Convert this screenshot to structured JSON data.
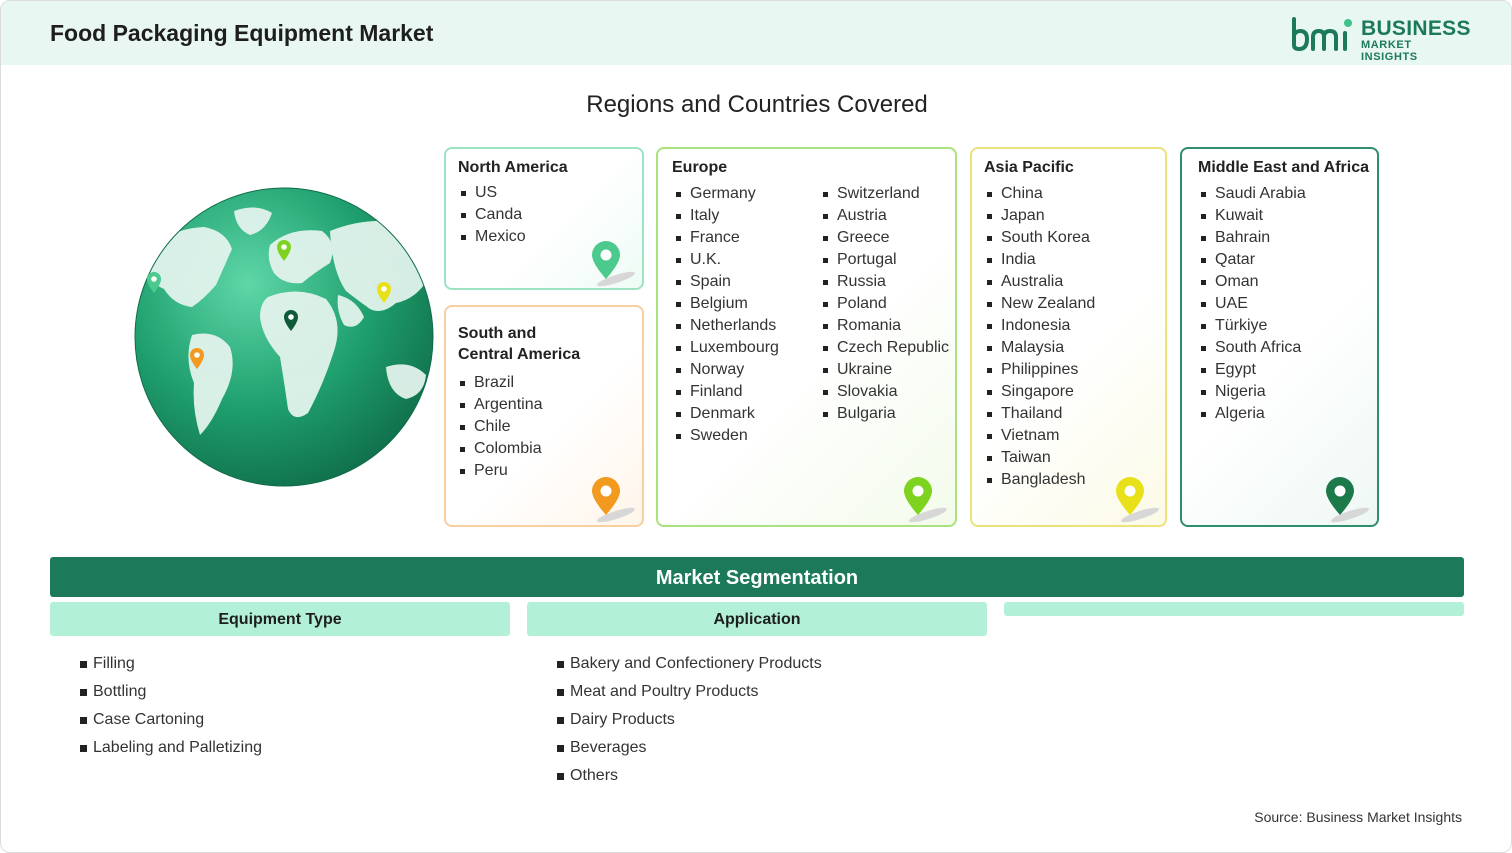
{
  "header": {
    "title": "Food Packaging Equipment Market",
    "logo": {
      "mark": "bmi",
      "word1": "BUSINESS",
      "word2": "MARKET INSIGHTS",
      "color": "#1c7a5a"
    }
  },
  "regions": {
    "title": "Regions and Countries Covered",
    "north_america": {
      "title": "North America",
      "countries": [
        "US",
        "Canda",
        "Mexico"
      ],
      "pin_color": "#4cc98c"
    },
    "south_central_america": {
      "title_line1": "South and",
      "title_line2": "Central America",
      "countries": [
        "Brazil",
        "Argentina",
        "Chile",
        "Colombia",
        "Peru"
      ],
      "pin_color": "#f29a1f"
    },
    "europe": {
      "title": "Europe",
      "countries_col1": [
        "Germany",
        "Italy",
        "France",
        "U.K.",
        "Spain",
        "Belgium",
        "Netherlands",
        "Luxembourg",
        "Norway",
        "Finland",
        "Denmark",
        "Sweden"
      ],
      "countries_col2": [
        "Switzerland",
        "Austria",
        "Greece",
        "Portugal",
        "Russia",
        "Poland",
        "Romania",
        "Czech Republic",
        "Ukraine",
        "Slovakia",
        "Bulgaria"
      ],
      "pin_color": "#7ed321"
    },
    "asia_pacific": {
      "title": "Asia Pacific",
      "countries": [
        "China",
        "Japan",
        "South Korea",
        "India",
        "Australia",
        "New Zealand",
        "Indonesia",
        "Malaysia",
        "Philippines",
        "Singapore",
        "Thailand",
        "Vietnam",
        "Taiwan",
        "Bangladesh"
      ],
      "pin_color": "#e8e018"
    },
    "middle_east_africa": {
      "title": "Middle East and Africa",
      "countries": [
        "Saudi Arabia",
        "Kuwait",
        "Bahrain",
        "Qatar",
        "Oman",
        "UAE",
        "Türkiye",
        "South Africa",
        "Egypt",
        "Nigeria",
        "Algeria"
      ],
      "pin_color": "#1c7a4a"
    }
  },
  "segmentation": {
    "title": "Market Segmentation",
    "equipment_type": {
      "title": "Equipment Type",
      "items": [
        "Filling",
        "Bottling",
        "Case Cartoning",
        "Labeling and Palletizing"
      ]
    },
    "application": {
      "title": "Application",
      "items": [
        "Bakery and Confectionery Products",
        "Meat and Poultry Products",
        "Dairy Products",
        "Beverages",
        "Others"
      ]
    }
  },
  "source": "Source: Business Market Insights",
  "colors": {
    "accent": "#1c7a5a",
    "light_accent": "#b2f0d7",
    "header_bg": "#e8f7f1"
  }
}
